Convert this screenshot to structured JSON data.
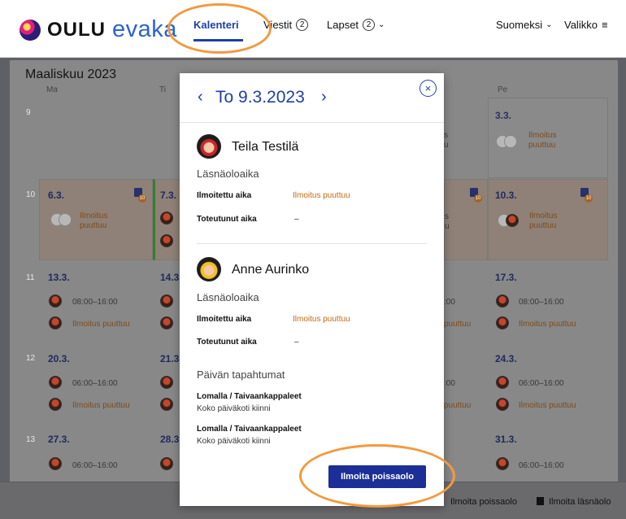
{
  "header": {
    "logo_city": "OULU",
    "logo_app": "evaka",
    "nav_calendar": "Kalenteri",
    "nav_messages": "Viestit",
    "nav_messages_count": "2",
    "nav_children": "Lapset",
    "nav_children_count": "2",
    "language": "Suomeksi",
    "menu": "Valikko",
    "menu_icon": "≡"
  },
  "calendar": {
    "month": "Maaliskuu 2023",
    "weekdays": [
      "Ma",
      "Ti",
      "Pe"
    ],
    "weeks": [
      "9",
      "10",
      "11",
      "12",
      "13"
    ],
    "dates": {
      "mon_10": "6.3.",
      "tue_10": "7.3.",
      "fri_9": "3.3.",
      "fri_10": "10.3.",
      "mon_11": "13.3.",
      "tue_11": "14.3",
      "fri_11": "17.3.",
      "mon_12": "20.3.",
      "tue_12": "21.3",
      "fri_12": "24.3.",
      "mon_13": "27.3.",
      "tue_13": "28.3",
      "fri_13": "31.3."
    },
    "missing_line1": "Ilmoitus",
    "missing_line2": "puuttuu",
    "missing_full": "Ilmoitus puuttuu",
    "time_range": "08:00–16:00",
    "time_range_late": "06:00–16:00",
    "partial_00": ":00",
    "partial_puuttuu": "puuttuu",
    "partial_s": "s",
    "partial_u": "u",
    "icon_badge": "10"
  },
  "bottom": {
    "report_absence": "Ilmoita poissaolo",
    "report_presence": "Ilmoita läsnäolo"
  },
  "modal": {
    "prev": "‹",
    "next": "›",
    "title": "To 9.3.2023",
    "close": "×",
    "child1_name": "Teila Testilä",
    "child2_name": "Anne Aurinko",
    "attendance_section": "Läsnäoloaika",
    "reported_time_label": "Ilmoitettu aika",
    "reported_time_value": "Ilmoitus puuttuu",
    "actual_time_label": "Toteutunut aika",
    "actual_time_value": "–",
    "events_section": "Päivän tapahtumat",
    "event1_title": "Lomalla / Taivaankappaleet",
    "event1_sub": "Koko päiväkoti kiinni",
    "event2_title": "Lomalla / Taivaankappaleet",
    "event2_sub": "Koko päiväkoti kiinni",
    "button": "Ilmoita poissaolo"
  },
  "colors": {
    "brand_blue": "#1e3fa4",
    "button_blue": "#1c2f96",
    "warning_orange": "#c46a12",
    "annotation_orange": "#f39a3e"
  }
}
